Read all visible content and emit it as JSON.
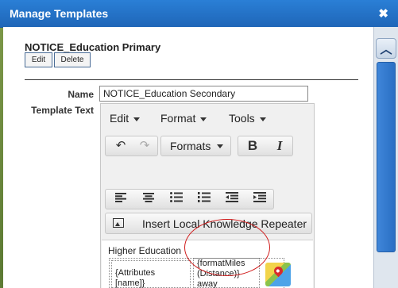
{
  "window": {
    "title": "Manage Templates",
    "close_glyph": "✖"
  },
  "template": {
    "name": "NOTICE_Education Primary",
    "edit_label": "Edit",
    "delete_label": "Delete"
  },
  "form": {
    "name_label": "Name",
    "name_value": "NOTICE_Education Secondary",
    "text_label": "Template Text"
  },
  "editor": {
    "menus": [
      "Edit",
      "Format",
      "Tools"
    ],
    "formats_label": "Formats",
    "insert_label": "Insert Local Knowledge Repeater",
    "heading": "Higher Education",
    "cell1": [
      "{Attributes",
      "[name]}"
    ],
    "cell2": [
      "{formatMiles",
      "(Distance)}",
      "away"
    ]
  },
  "icons": [
    "close-icon",
    "scroll-up-icon",
    "undo-icon",
    "redo-icon",
    "bold-icon",
    "italic-icon",
    "align-left-icon",
    "align-center-icon",
    "bullet-list-icon",
    "numbered-list-icon",
    "outdent-icon",
    "indent-icon",
    "image-icon",
    "map-pin-icon"
  ],
  "colors": {
    "titlebar": "#1f66b8",
    "annotation": "#d01a1a",
    "scroll_thumb": "#2a6fc4"
  }
}
